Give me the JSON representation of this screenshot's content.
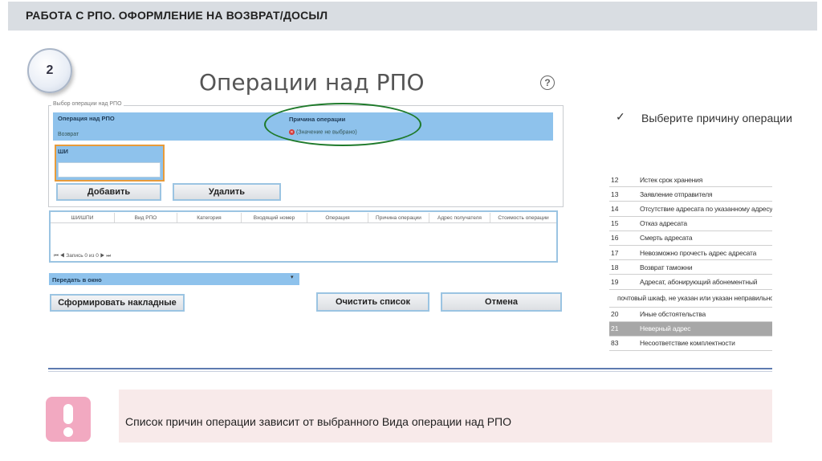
{
  "header": {
    "title": "РАБОТА С РПО. ОФОРМЛЕНИЕ НА ВОЗВРАТ/ДОСЫЛ"
  },
  "step": {
    "number": "2"
  },
  "dialog": {
    "title": "Операции над РПО",
    "help_glyph": "?",
    "fieldset_legend": "Выбор операции над РПО",
    "operation_label": "Операция над РПО",
    "operation_value": "Возврат",
    "reason_label": "Причина операции",
    "reason_placeholder": "(Значение не выбрано)",
    "shi_label": "ШИ",
    "shi_value": "",
    "add_button": "Добавить",
    "delete_button": "Удалить",
    "table_columns": [
      "ШИ/ШПИ",
      "Вид РПО",
      "Категория",
      "Входящий номер",
      "Операция",
      "Причина операции",
      "Адрес получателя",
      "Стоимость операции"
    ],
    "pager_text": "Запись 0 из 0",
    "pager_first": "⏮",
    "pager_prev": "◀",
    "pager_next": "▶",
    "pager_last": "⏭",
    "send_to_window": "Передать в окно",
    "form_invoices_button": "Сформировать накладные",
    "clear_list_button": "Очистить список",
    "cancel_button": "Отмена"
  },
  "bullet": {
    "check_glyph": "✓",
    "text": "Выберите причину операции"
  },
  "reasons": [
    {
      "code": "12",
      "text": "Истек срок хранения",
      "highlighted": false
    },
    {
      "code": "13",
      "text": "Заявление отправителя",
      "highlighted": false
    },
    {
      "code": "14",
      "text": "Отсутствие адресата по указанному адресу",
      "highlighted": false
    },
    {
      "code": "15",
      "text": "Отказ адресата",
      "highlighted": false
    },
    {
      "code": "16",
      "text": "Смерть адресата",
      "highlighted": false
    },
    {
      "code": "17",
      "text": "Невозможно прочесть адрес адресата",
      "highlighted": false
    },
    {
      "code": "18",
      "text": "Возврат таможни",
      "highlighted": false
    },
    {
      "code": "19",
      "text": "Адресат, абонирующий абонементный",
      "highlighted": false
    },
    {
      "code": "",
      "text": "почтовый шкаф, не указан или указан неправильно",
      "highlighted": false
    },
    {
      "code": "20",
      "text": "Иные обстоятельства",
      "highlighted": false
    },
    {
      "code": "21",
      "text": "Неверный адрес",
      "highlighted": true
    },
    {
      "code": "83",
      "text": "Несоответствие комплектности",
      "highlighted": false
    }
  ],
  "note": {
    "text": "Список причин операции зависит от выбранного Вида операции над РПО"
  },
  "colors": {
    "header_band": "#d9dde2",
    "field_band": "#8ec2ec",
    "highlight_border": "#e89b3a",
    "ellipse": "#1f7a2b",
    "note_icon": "#f2a9c1",
    "note_bg": "#f8eaea",
    "divider": "#5d7bb0"
  }
}
